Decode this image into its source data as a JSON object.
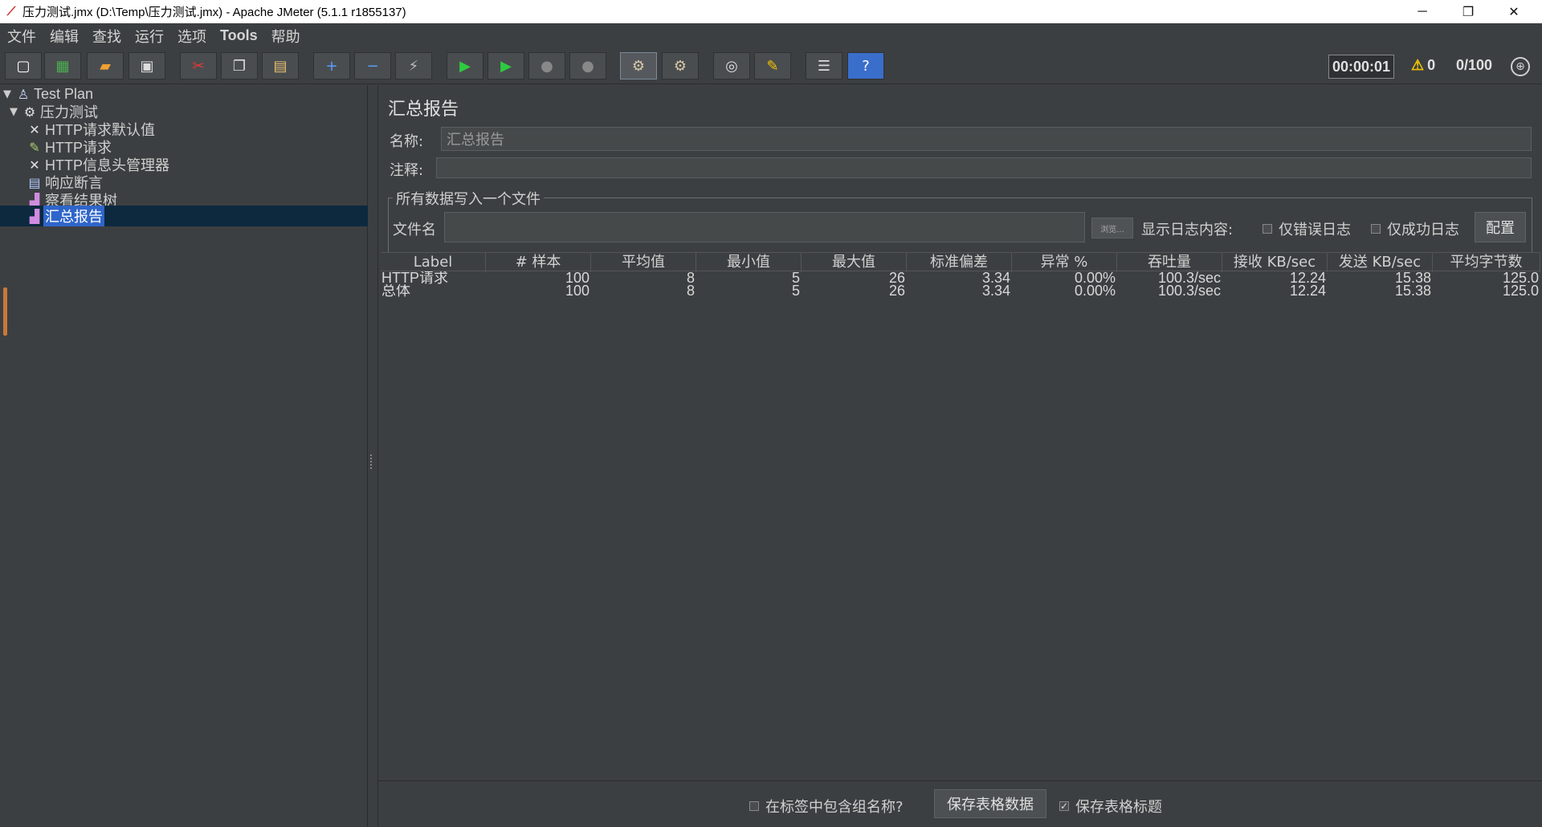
{
  "window": {
    "title": "压力测试.jmx (D:\\Temp\\压力测试.jmx) - Apache JMeter (5.1.1 r1855137)",
    "minimize": "─",
    "restore": "❐",
    "close": "✕"
  },
  "menu": [
    "文件",
    "编辑",
    "查找",
    "运行",
    "选项",
    "Tools",
    "帮助"
  ],
  "toolbar": {
    "buttons": [
      {
        "name": "new-icon",
        "glyph": "▢",
        "color": "#ffffff"
      },
      {
        "name": "templates-icon",
        "glyph": "▦",
        "color": "#4caf50"
      },
      {
        "name": "open-icon",
        "glyph": "▰",
        "color": "#f0a030"
      },
      {
        "name": "save-icon",
        "glyph": "▣",
        "color": "#dddddd"
      },
      {
        "name": "cut-icon",
        "glyph": "✂",
        "color": "#e53935"
      },
      {
        "name": "copy-icon",
        "glyph": "❐",
        "color": "#dddddd"
      },
      {
        "name": "paste-icon",
        "glyph": "▤",
        "color": "#e8c070"
      },
      {
        "name": "expand-icon",
        "glyph": "+",
        "color": "#5aa0ff"
      },
      {
        "name": "collapse-icon",
        "glyph": "−",
        "color": "#5aa0ff"
      },
      {
        "name": "toggle-icon",
        "glyph": "⚡",
        "color": "#bbbbbb"
      },
      {
        "name": "start-icon",
        "glyph": "▶",
        "color": "#2ecc40"
      },
      {
        "name": "start-no-pause-icon",
        "glyph": "▶",
        "color": "#2ecc40"
      },
      {
        "name": "stop-icon",
        "glyph": "●",
        "color": "#888888"
      },
      {
        "name": "shutdown-icon",
        "glyph": "●",
        "color": "#888888"
      },
      {
        "name": "clear-icon",
        "glyph": "⚙",
        "color": "#d8c8a8"
      },
      {
        "name": "clear-all-icon",
        "glyph": "⚙",
        "color": "#d8c8a8"
      },
      {
        "name": "search-icon",
        "glyph": "◎",
        "color": "#dddddd"
      },
      {
        "name": "reset-search-icon",
        "glyph": "✎",
        "color": "#f5c400"
      },
      {
        "name": "function-helper-icon",
        "glyph": "☰",
        "color": "#dddddd"
      },
      {
        "name": "help-icon",
        "glyph": "?",
        "color": "#ffffff"
      }
    ],
    "timer": "00:00:01",
    "warnings": "0",
    "threads": "0/100"
  },
  "tree": {
    "items": [
      {
        "label": "Test Plan",
        "icon": "flask-icon",
        "glyph": "♙"
      },
      {
        "label": "压力测试",
        "icon": "thread-group-gear-icon",
        "glyph": "⚙"
      },
      {
        "label": "HTTP请求默认值",
        "icon": "wrench-icon",
        "glyph": "✕"
      },
      {
        "label": "HTTP请求",
        "icon": "pipette-icon",
        "glyph": "✎"
      },
      {
        "label": "HTTP信息头管理器",
        "icon": "wrench-icon",
        "glyph": "✕"
      },
      {
        "label": "响应断言",
        "icon": "assertion-icon",
        "glyph": "▤"
      },
      {
        "label": "察看结果树",
        "icon": "chart-icon",
        "glyph": "▟"
      },
      {
        "label": "汇总报告",
        "icon": "chart-icon",
        "glyph": "▟"
      }
    ]
  },
  "panel": {
    "title": "汇总报告",
    "name_label": "名称:",
    "name_value": "汇总报告",
    "comment_label": "注释:",
    "comment_value": "",
    "group_title": "所有数据写入一个文件",
    "file_label": "文件名",
    "file_value": "",
    "browse": "浏览...",
    "log_label": "显示日志内容:",
    "errors_only": "仅错误日志",
    "success_only": "仅成功日志",
    "configure": "配置"
  },
  "table": {
    "headers": [
      "Label",
      "# 样本",
      "平均值",
      "最小值",
      "最大值",
      "标准偏差",
      "异常 %",
      "吞吐量",
      "接收 KB/sec",
      "发送 KB/sec",
      "平均字节数"
    ],
    "rows": [
      [
        "HTTP请求",
        "100",
        "8",
        "5",
        "26",
        "3.34",
        "0.00%",
        "100.3/sec",
        "12.24",
        "15.38",
        "125.0"
      ],
      [
        "总体",
        "100",
        "8",
        "5",
        "26",
        "3.34",
        "0.00%",
        "100.3/sec",
        "12.24",
        "15.38",
        "125.0"
      ]
    ]
  },
  "bottom": {
    "include_group": "在标签中包含组名称?",
    "include_group_checked": false,
    "save_table": "保存表格数据",
    "save_header": "保存表格标题",
    "save_header_checked": true
  }
}
